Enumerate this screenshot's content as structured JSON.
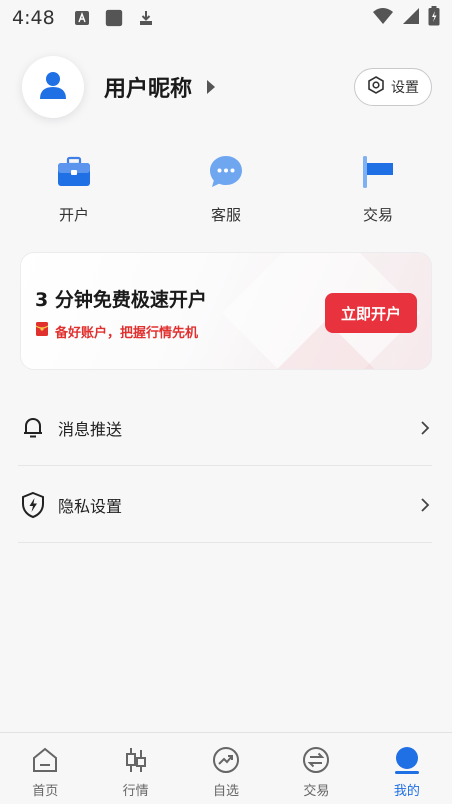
{
  "status_bar": {
    "time": "4:48",
    "icons": [
      "text-input-icon",
      "app-square-icon",
      "download-icon",
      "wifi-icon",
      "signal-icon",
      "battery-icon"
    ]
  },
  "profile": {
    "nickname": "用户昵称",
    "settings_label": "设置"
  },
  "quick_actions": [
    {
      "label": "开户",
      "icon": "briefcase-icon"
    },
    {
      "label": "客服",
      "icon": "chat-bubble-icon"
    },
    {
      "label": "交易",
      "icon": "flag-icon"
    }
  ],
  "promo": {
    "title": "3 分钟免费极速开户",
    "subtitle": "备好账户，把握行情先机",
    "button_label": "立即开户"
  },
  "list": [
    {
      "label": "消息推送",
      "icon": "bell-icon"
    },
    {
      "label": "隐私设置",
      "icon": "shield-icon"
    }
  ],
  "tabbar": [
    {
      "label": "首页",
      "icon": "home-icon",
      "active": false
    },
    {
      "label": "行情",
      "icon": "candlestick-icon",
      "active": false
    },
    {
      "label": "自选",
      "icon": "trend-icon",
      "active": false
    },
    {
      "label": "交易",
      "icon": "exchange-icon",
      "active": false
    },
    {
      "label": "我的",
      "icon": "user-icon",
      "active": true
    }
  ],
  "colors": {
    "accent_blue": "#1f6fe5",
    "promo_red": "#e8333f",
    "background": "#f7f7f8"
  }
}
